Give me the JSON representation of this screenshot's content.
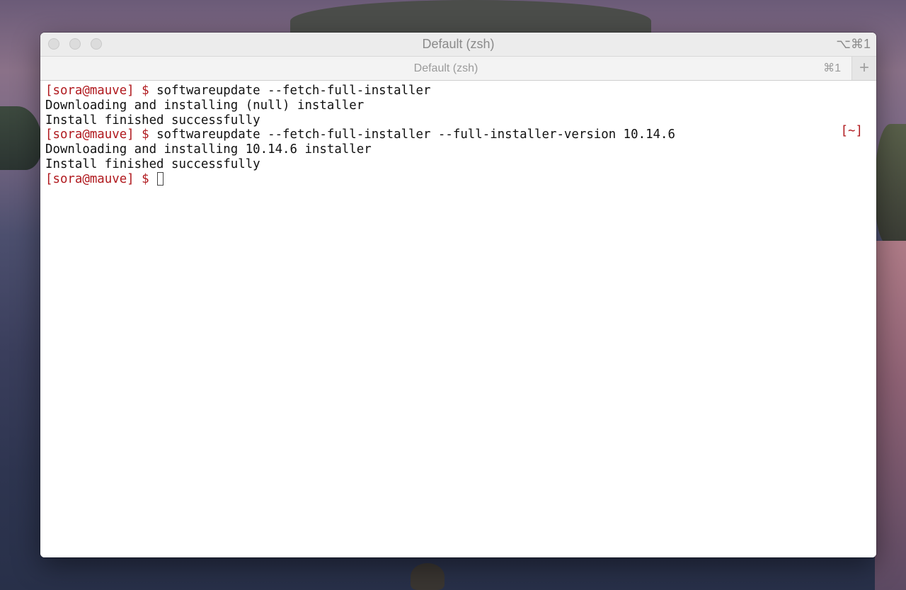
{
  "window": {
    "title": "Default (zsh)",
    "title_shortcut": "⌥⌘1"
  },
  "tabs": [
    {
      "label": "Default (zsh)",
      "shortcut": "⌘1"
    }
  ],
  "new_tab_label": "+",
  "terminal": {
    "lines": [
      {
        "prompt": "[sora@mauve] $ ",
        "text": "softwareupdate --fetch-full-installer"
      },
      {
        "prompt": "",
        "text": "Downloading and installing (null) installer"
      },
      {
        "prompt": "",
        "text": "Install finished successfully"
      },
      {
        "prompt": "[sora@mauve] $ ",
        "text": "softwareupdate --fetch-full-installer --full-installer-version 10.14.6"
      },
      {
        "prompt": "",
        "text": "Downloading and installing 10.14.6 installer"
      },
      {
        "prompt": "",
        "text": "Install finished successfully"
      },
      {
        "prompt": "[sora@mauve] $ ",
        "text": ""
      }
    ],
    "right_prompt": "[~]"
  },
  "colors": {
    "prompt": "#b0191e",
    "text": "#111111",
    "background": "#ffffff"
  }
}
